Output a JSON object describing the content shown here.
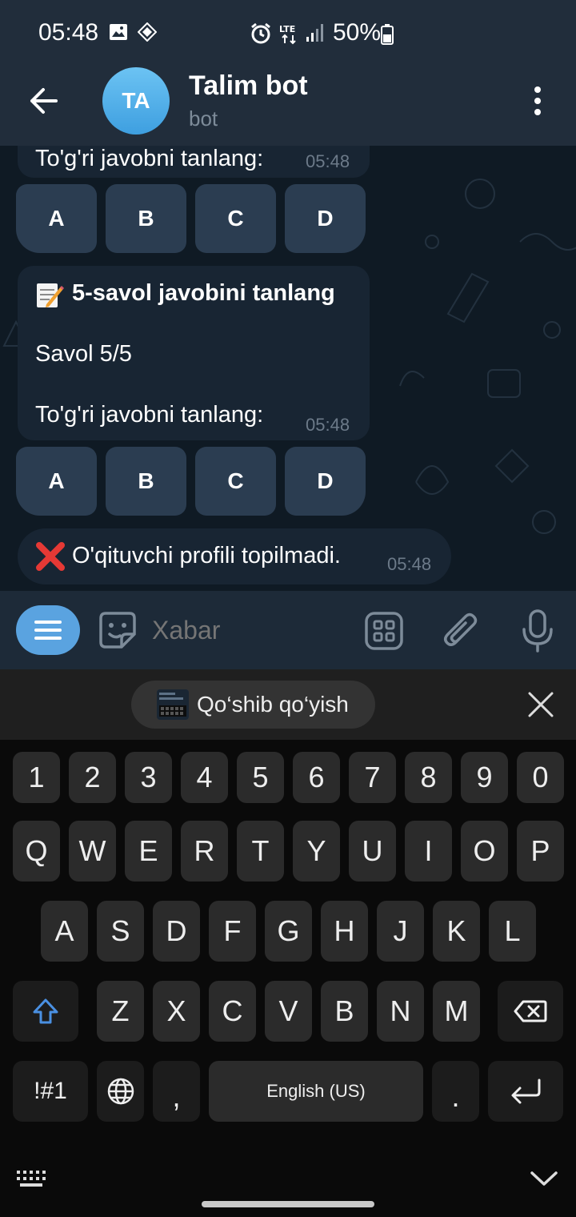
{
  "status_bar": {
    "time": "05:48",
    "battery": "50%",
    "icons": [
      "gallery-icon",
      "nfc-icon",
      "alarm-icon",
      "lte-icon",
      "signal-icon",
      "battery-icon"
    ]
  },
  "header": {
    "avatar_initials": "TA",
    "title": "Talim bot",
    "subtitle": "bot"
  },
  "messages": [
    {
      "text": "To'g'ri javobni tanlang:",
      "time": "05:48"
    },
    {
      "title": "5-savol javobini tanlang",
      "line2": "Savol 5/5",
      "line3": "To'g'ri javobni tanlang:",
      "time": "05:48"
    },
    {
      "text": "O'qituvchi profili topilmadi.",
      "time": "05:48"
    }
  ],
  "inline_keyboard_1": [
    "A",
    "B",
    "C",
    "D"
  ],
  "inline_keyboard_2": [
    "A",
    "B",
    "C",
    "D"
  ],
  "input": {
    "placeholder": "Xabar"
  },
  "keyboard": {
    "suggestion": "Qo‘shib qo‘yish",
    "row_numbers": [
      "1",
      "2",
      "3",
      "4",
      "5",
      "6",
      "7",
      "8",
      "9",
      "0"
    ],
    "row_q": [
      "Q",
      "W",
      "E",
      "R",
      "T",
      "Y",
      "U",
      "I",
      "O",
      "P"
    ],
    "row_a": [
      "A",
      "S",
      "D",
      "F",
      "G",
      "H",
      "J",
      "K",
      "L"
    ],
    "row_z": [
      "Z",
      "X",
      "C",
      "V",
      "B",
      "N",
      "M"
    ],
    "symbols_key": "!#1",
    "comma": ",",
    "space": "English (US)",
    "period": "."
  },
  "colors": {
    "header_bg": "#212d3b",
    "bubble_bg": "#182533",
    "button_bg": "#2b3d51",
    "accent": "#5aa3e0",
    "error": "#e53935"
  }
}
